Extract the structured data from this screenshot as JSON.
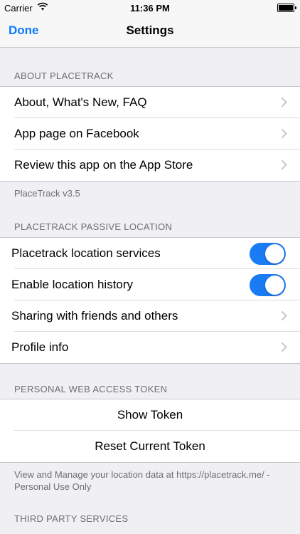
{
  "status_bar": {
    "carrier": "Carrier",
    "time": "11:36 PM",
    "battery_level": 1.0
  },
  "nav": {
    "done_label": "Done",
    "title": "Settings"
  },
  "sections": {
    "about": {
      "header": "ABOUT PLACETRACK",
      "rows": [
        {
          "label": "About, What's New, FAQ"
        },
        {
          "label": "App page on Facebook"
        },
        {
          "label": "Review this app on the App Store"
        }
      ],
      "footer": "PlaceTrack v3.5"
    },
    "passive": {
      "header": "PLACETRACK PASSIVE LOCATION",
      "rows": [
        {
          "label": "Placetrack location services",
          "toggle": true
        },
        {
          "label": "Enable location history",
          "toggle": true
        },
        {
          "label": "Sharing with friends and others"
        },
        {
          "label": "Profile info"
        }
      ]
    },
    "token": {
      "header": "PERSONAL WEB ACCESS TOKEN",
      "rows": [
        {
          "label": "Show Token"
        },
        {
          "label": "Reset Current Token"
        }
      ],
      "footer": "View and Manage your location data at https://placetrack.me/ - Personal Use Only"
    },
    "third_party": {
      "header": "THIRD PARTY SERVICES"
    }
  },
  "colors": {
    "accent": "#0a7aff",
    "toggle_on": "#1a7cf5",
    "background": "#efeff4"
  }
}
